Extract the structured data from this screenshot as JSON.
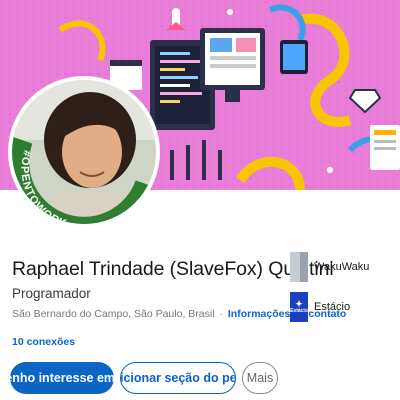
{
  "profile": {
    "name": "Raphael Trindade (SlaveFox) Quintini",
    "headline": "Programador",
    "location": "São Bernardo do Campo, São Paulo, Brasil",
    "separator": "·",
    "contact_info": "Informações de contato",
    "connections": "10 conexões",
    "open_to_work_badge": "#OPENTOWORK"
  },
  "companies": [
    {
      "name": "WakuWaku",
      "logo": "wakuwaku-logo"
    },
    {
      "name": "Estácio",
      "logo": "estacio-logo",
      "logo_text": "Estácio"
    }
  ],
  "actions": {
    "primary": "Tenho interesse em...",
    "secondary": "Adicionar seção do perfil",
    "more": "Mais"
  },
  "colors": {
    "accent": "#0a66c2",
    "banner": "#e879d8",
    "open_to_work": "#2e7d32"
  }
}
